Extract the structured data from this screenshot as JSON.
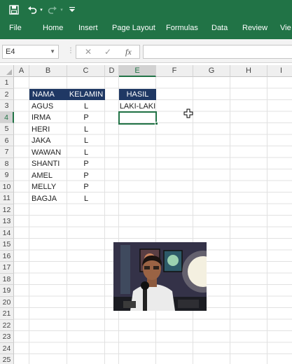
{
  "quick_access": {
    "save_icon": "save-icon",
    "undo_icon": "undo-icon",
    "redo_icon": "redo-icon",
    "customize_icon": "customize-qat-icon"
  },
  "ribbon": {
    "tabs": [
      "File",
      "Home",
      "Insert",
      "Page Layout",
      "Formulas",
      "Data",
      "Review",
      "Vie"
    ]
  },
  "formula_bar": {
    "name_box": "E4",
    "cancel_symbol": "✕",
    "enter_symbol": "✓",
    "function_symbol": "fx",
    "formula": ""
  },
  "sheet": {
    "columns": [
      "A",
      "B",
      "C",
      "D",
      "E",
      "F",
      "G",
      "H",
      "I"
    ],
    "rows": [
      "1",
      "2",
      "3",
      "4",
      "5",
      "6",
      "7",
      "8",
      "9",
      "10",
      "11",
      "12",
      "13",
      "14",
      "15",
      "16",
      "17",
      "18",
      "19",
      "20",
      "21",
      "22",
      "23",
      "24",
      "25"
    ],
    "selected_cell": "E4",
    "table_headers": {
      "nama": "NAMA",
      "kelamin": "KELAMIN",
      "hasil": "HASIL"
    },
    "records": [
      {
        "nama": "AGUS",
        "kelamin": "L"
      },
      {
        "nama": "IRMA",
        "kelamin": "P"
      },
      {
        "nama": "HERI",
        "kelamin": "L"
      },
      {
        "nama": "JAKA",
        "kelamin": "L"
      },
      {
        "nama": "WAWAN",
        "kelamin": "L"
      },
      {
        "nama": "SHANTI",
        "kelamin": "P"
      },
      {
        "nama": "AMEL",
        "kelamin": "P"
      },
      {
        "nama": "MELLY",
        "kelamin": "P"
      },
      {
        "nama": "BAGJA",
        "kelamin": "L"
      }
    ],
    "hasil_value": "LAKI-LAKI"
  },
  "colors": {
    "excel_green": "#217346",
    "header_fill": "#1f3864"
  }
}
